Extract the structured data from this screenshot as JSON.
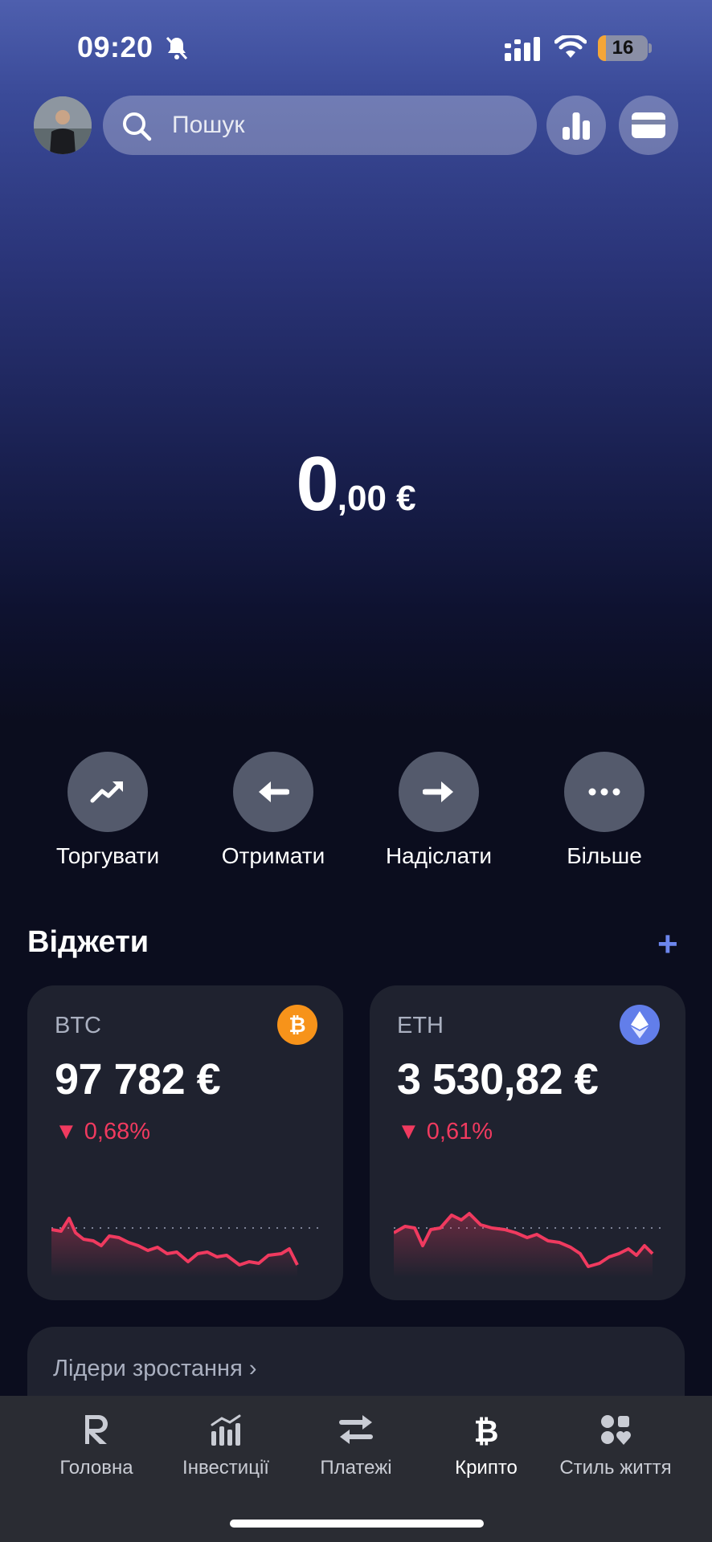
{
  "status_bar": {
    "time": "09:20",
    "battery": "16",
    "battery_level": 0.16
  },
  "search": {
    "placeholder": "Пошук"
  },
  "balance": {
    "integer": "0",
    "decimals": ",00 €"
  },
  "actions": [
    {
      "label": "Торгувати",
      "icon": "trending-up-icon"
    },
    {
      "label": "Отримати",
      "icon": "arrow-left-icon"
    },
    {
      "label": "Надіслати",
      "icon": "arrow-right-icon"
    },
    {
      "label": "Більше",
      "icon": "more-icon"
    }
  ],
  "widgets": {
    "title": "Віджети",
    "add_label": "+",
    "cards": [
      {
        "symbol": "BTC",
        "price": "97 782 €",
        "change": "0,68%",
        "coin_color": "#f7931a",
        "change_color": "#f03a5f"
      },
      {
        "symbol": "ETH",
        "price": "3 530,82 €",
        "change": "0,61%",
        "coin_color": "#627eea",
        "change_color": "#f03a5f"
      }
    ]
  },
  "leaders": {
    "title": "Лідери зростання"
  },
  "tabs": [
    {
      "label": "Головна",
      "icon": "revolut-r-icon"
    },
    {
      "label": "Інвестиції",
      "icon": "invest-chart-icon"
    },
    {
      "label": "Платежі",
      "icon": "transfer-arrows-icon"
    },
    {
      "label": "Крипто",
      "icon": "bitcoin-icon",
      "active": true
    },
    {
      "label": "Стиль життя",
      "icon": "lifestyle-icon"
    }
  ],
  "colors": {
    "accent": "#6c86ee",
    "negative": "#f03a5f",
    "card_bg": "#1f222f"
  }
}
